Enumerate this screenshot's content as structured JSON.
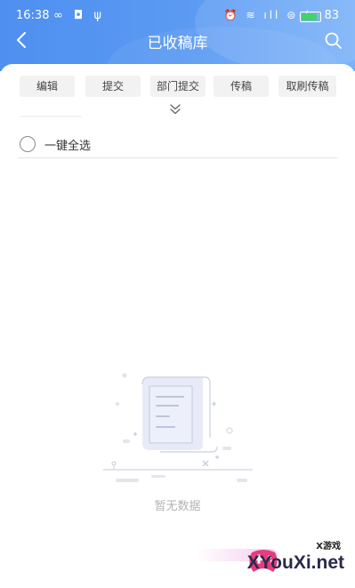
{
  "status_bar": {
    "time": "16:38",
    "left_icons": "∞ ◘ ψ",
    "right_icons": "⏰ ≋ ıll ⊜ ϟ",
    "battery_level": "83",
    "battery_percent": 0.83
  },
  "header": {
    "title": "已收稿库",
    "back_icon": "chevron-left-icon",
    "search_icon": "search-icon"
  },
  "toolbar": {
    "buttons": [
      "编辑",
      "提交",
      "部门提交",
      "传稿",
      "取刷传稿"
    ],
    "expand_icon": "double-chevron-down-icon"
  },
  "select_all": {
    "label": "一键全选",
    "checked": false
  },
  "empty_state": {
    "text": "暂无数据",
    "icon": "empty-document-icon"
  },
  "watermark": {
    "tag": "X游戏",
    "name": "XYouXi.net",
    "icon": "gamepad-logo-icon"
  },
  "colors": {
    "header_start": "#4e8ff0",
    "header_end": "#7bb2f8",
    "button_bg": "#f2f2f2",
    "empty_text": "#b3b3b3"
  }
}
